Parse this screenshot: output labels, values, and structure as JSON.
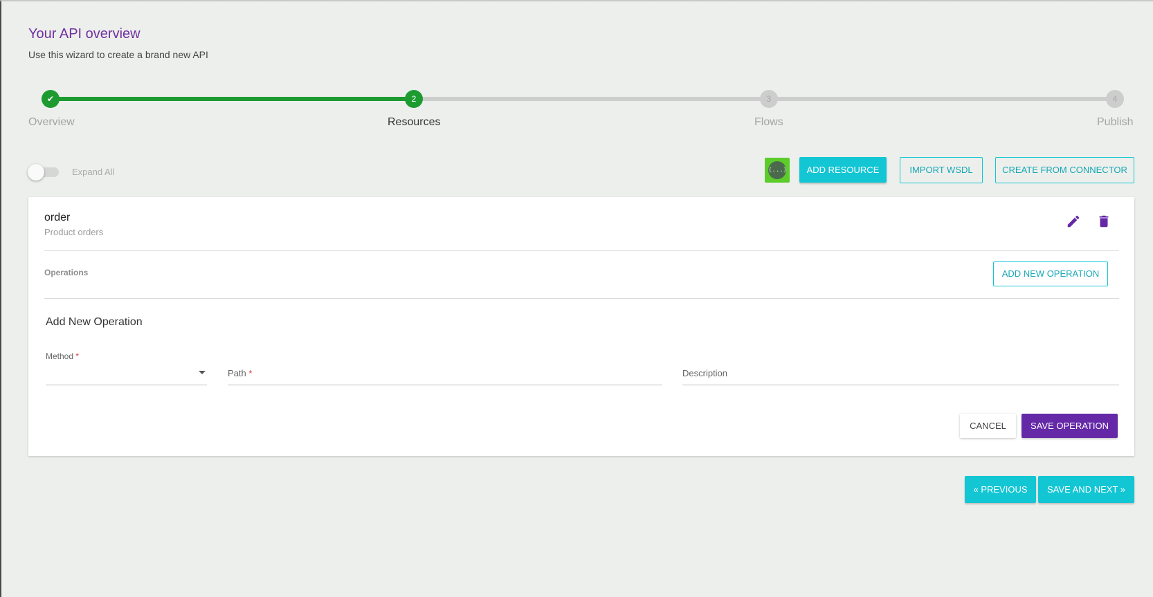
{
  "header": {
    "title": "Your API overview",
    "subtitle": "Use this wizard to create a brand new API"
  },
  "stepper": {
    "steps": [
      {
        "label": "Overview",
        "marker": "✔",
        "state": "completed"
      },
      {
        "label": "Resources",
        "marker": "2",
        "state": "current"
      },
      {
        "label": "Flows",
        "marker": "3",
        "state": "pending"
      },
      {
        "label": "Publish",
        "marker": "4",
        "state": "pending"
      }
    ]
  },
  "toolbar": {
    "expand_all_label": "Expand All",
    "expand_all_on": false,
    "json_icon_text": "{...}",
    "add_resource_label": "ADD RESOURCE",
    "import_wsdl_label": "IMPORT WSDL",
    "create_from_connector_label": "CREATE FROM CONNECTOR"
  },
  "resource": {
    "name": "order",
    "description": "Product orders",
    "operations_label": "Operations",
    "add_new_operation_label": "ADD NEW OPERATION"
  },
  "new_operation_form": {
    "title": "Add New Operation",
    "method_label": "Method",
    "required_marker": "*",
    "path_placeholder": "Path",
    "description_placeholder": "Description",
    "cancel_label": "CANCEL",
    "save_label": "SAVE OPERATION"
  },
  "footer": {
    "previous_label": "« PREVIOUS",
    "save_next_label": "SAVE AND NEXT »"
  },
  "colors": {
    "accent_purple": "#6529a8",
    "teal": "#12c6d4",
    "step_green": "#1d9b31",
    "background": "#ecefeb"
  }
}
